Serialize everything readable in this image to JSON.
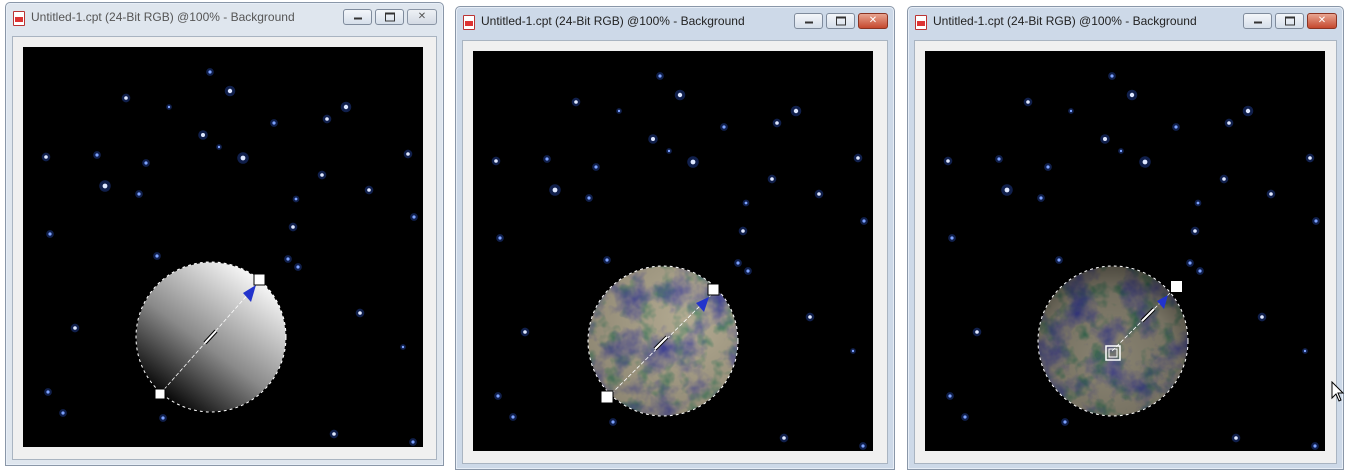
{
  "windows": [
    {
      "title": "Untitled-1.cpt (24-Bit RGB) @100% - Background",
      "active": false,
      "fill": "gradient"
    },
    {
      "title": "Untitled-1.cpt (24-Bit RGB) @100% - Background",
      "active": true,
      "fill": "texture"
    },
    {
      "title": "Untitled-1.cpt (24-Bit RGB) @100% - Background",
      "active": true,
      "fill": "texture-shaded"
    }
  ],
  "window_controls": {
    "minimize": "minimize-icon",
    "maximize": "maximize-icon",
    "close": "close-icon"
  },
  "colors": {
    "canvas_bg": "#000000",
    "star": "#5a8cff",
    "handle_arrow": "#2233cc",
    "texture_blue": "#4a4a9a",
    "texture_green": "#5c8a6c",
    "texture_sand": "#b6ad93"
  }
}
